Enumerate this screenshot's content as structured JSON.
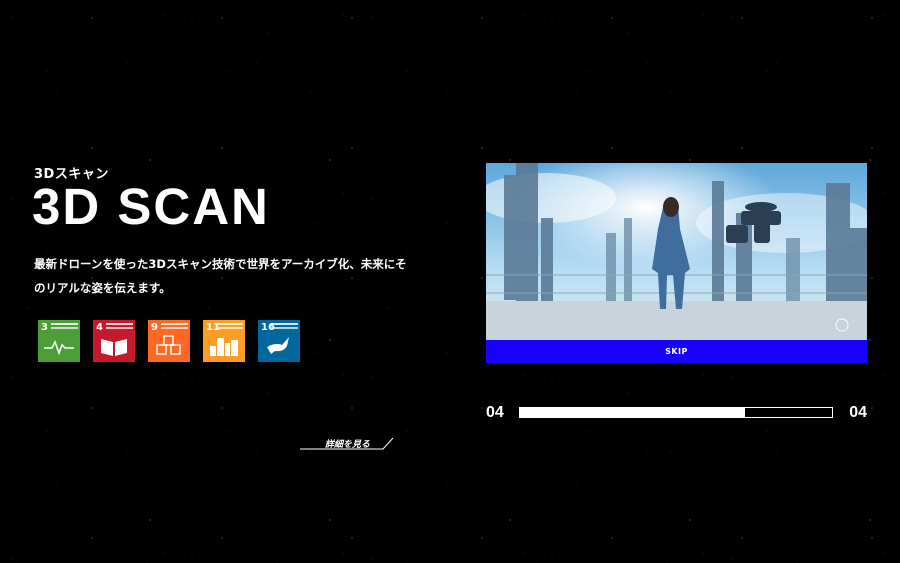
{
  "hero": {
    "subtitle": "3Dスキャン",
    "title": "3D SCAN",
    "description": "最新ドローンを使った3Dスキャン技術で世界をアーカイブ化、未来にそのリアルな姿を伝えます。"
  },
  "sdgs": [
    {
      "number": "3",
      "color": "#4c9f38",
      "icon": "heartbeat-icon"
    },
    {
      "number": "4",
      "color": "#c5192d",
      "icon": "book-icon"
    },
    {
      "number": "9",
      "color": "#fd6925",
      "icon": "cubes-icon"
    },
    {
      "number": "11",
      "color": "#fd9d24",
      "icon": "buildings-icon"
    },
    {
      "number": "16",
      "color": "#00689d",
      "icon": "dove-icon"
    }
  ],
  "detail_link": {
    "label": "詳細を見る"
  },
  "video": {
    "skip_label": "SKIP",
    "current": "04",
    "total": "04",
    "progress": 0.72
  },
  "colors": {
    "skip_bar": "#1800ff",
    "background": "#000000"
  }
}
